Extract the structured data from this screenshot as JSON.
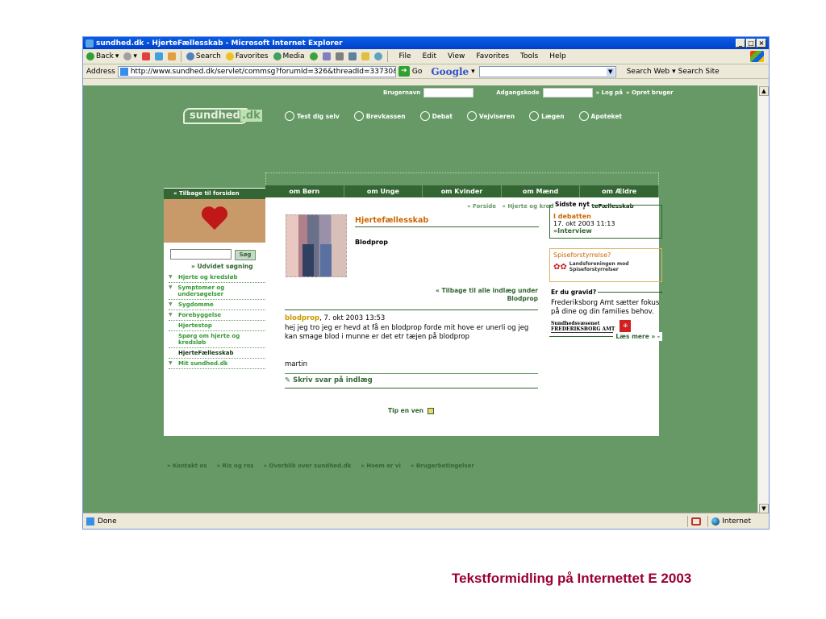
{
  "window": {
    "title": "sundhed.dk - HjerteFællesskab - Microsoft Internet Explorer",
    "controls": [
      "_",
      "□",
      "×"
    ]
  },
  "toolbar": {
    "back": "Back",
    "search": "Search",
    "favorites": "Favorites",
    "media": "Media",
    "menus": [
      "File",
      "Edit",
      "View",
      "Favorites",
      "Tools",
      "Help"
    ]
  },
  "address_bar": {
    "label": "Address",
    "url": "http://www.sundhed.dk/servlet/commsg?forumId=326&threadId=33730&cx=33€",
    "go": "Go",
    "google": "Google",
    "search_web": "Search Web",
    "search_site": "Search Site"
  },
  "site": {
    "logo_main": "sundhed",
    "logo_dk": ".dk",
    "login": {
      "username_label": "Brugernavn",
      "password_label": "Adgangskode",
      "login_link": "» Log på",
      "register_link": "» Opret bruger"
    },
    "top_nav": [
      "Test dig selv",
      "Brevkassen",
      "Debat",
      "Vejviseren",
      "Lægen",
      "Apoteket"
    ],
    "back_home": "« Tilbage til forsiden",
    "search_button": "Søg",
    "advanced_search": "» Udvidet søgning",
    "side_menu": [
      {
        "label": "Hjerte og kredsløb",
        "tri": "▼",
        "level": 0
      },
      {
        "label": "Symptomer og undersøgelser",
        "tri": "▼",
        "level": 0
      },
      {
        "label": "Sygdomme",
        "tri": "▼",
        "level": 0
      },
      {
        "label": "Forebyggelse",
        "tri": "▼",
        "level": 0
      },
      {
        "label": "Hjertestop",
        "tri": "",
        "level": 1
      },
      {
        "label": "Spørg om hjerte og kredsløb",
        "tri": "",
        "level": 1
      },
      {
        "label": "HjerteFællesskab",
        "tri": "",
        "level": 1
      },
      {
        "label": "Mit sundhed.dk",
        "tri": "▼",
        "level": 0
      }
    ],
    "main_nav": [
      "om Børn",
      "om Unge",
      "om Kvinder",
      "om Mænd",
      "om Ældre"
    ],
    "breadcrumbs": {
      "b1": "« Forside",
      "b2": "« Hjerte og kredsløb",
      "b3": "« HjerteFællesskab"
    },
    "forum_title": "Hjertefællesskab",
    "thread_title": "Blodprop",
    "back_all": "« Tilbage til alle indlæg under Blodprop",
    "post": {
      "author": "blodprop",
      "date": ", 7. okt 2003 13:53",
      "body": "hej jeg tro jeg er hevd at få en blodprop forde mit hove er unerli og jeg kan smage blod i munne er det etr tæjen på blodprop",
      "signature": "martin"
    },
    "reply": "Skriv svar på indlæg",
    "tip": "Tip en ven",
    "latest": {
      "legend": "Sidste nyt",
      "title": "I debatten",
      "meta": "17. okt 2003 11:13",
      "link": "»Interview"
    },
    "eating": {
      "question": "Spiseforstyrrelse?",
      "org": "Landsforeningen mod Spiseforstyrrelser"
    },
    "pregnant": {
      "legend": "Er du gravid?",
      "dash": "-",
      "text": "Frederiksborg Amt sætter fokus på dine og din families behov.",
      "org_line1": "Sundhedsvæsenet",
      "org_line2": "FREDERIKSBORG AMT",
      "more": "Læs mere » -"
    },
    "footer": [
      "» Kontakt os",
      "» Ris og ros",
      "» Overblik over sundhed.dk",
      "» Hvem er vi",
      "» Brugerbetingelser"
    ]
  },
  "status": {
    "text": "Done",
    "zone": "Internet"
  },
  "caption": "Tekstformidling på Internettet E 2003"
}
